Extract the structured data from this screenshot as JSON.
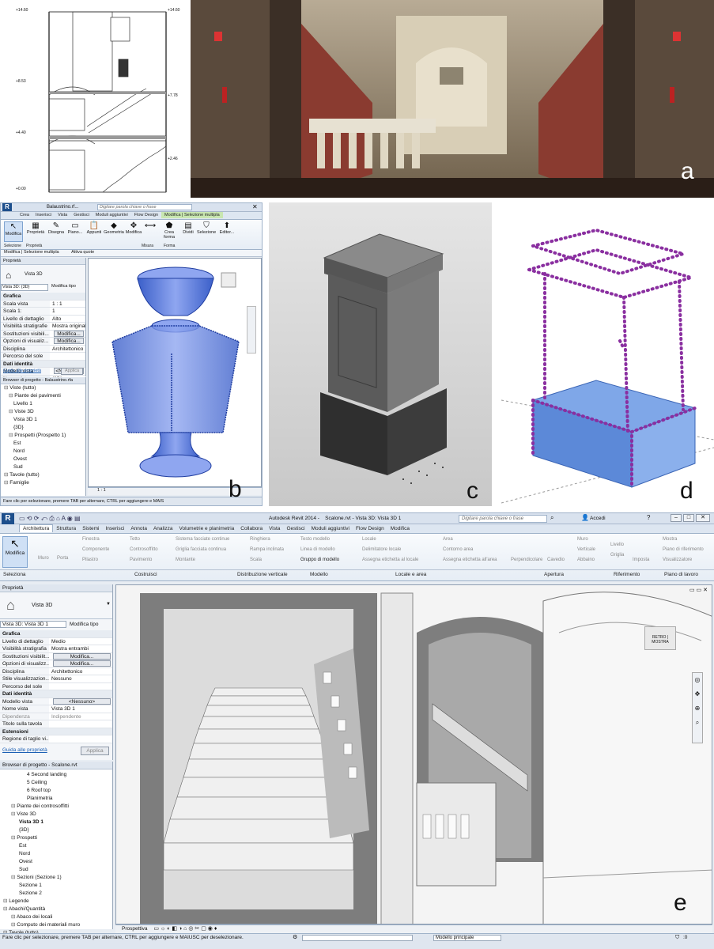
{
  "labels": {
    "a": "a",
    "b": "b",
    "c": "c",
    "d": "d",
    "e": "e"
  },
  "section_drawing": {
    "levels": [
      "+14.60",
      "+8.53",
      "+4.40",
      "+0.00",
      "+14.60",
      "+7.78",
      "+2.46"
    ]
  },
  "revit_small": {
    "file_title": "Balaustrino.rf...",
    "search_placeholder": "Digitare parola chiave o frase",
    "tabs": [
      "Crea",
      "Inserisci",
      "Vista",
      "Gestisci",
      "Moduli aggiuntivi",
      "Flow Design",
      "Modifica | Selezione multipla"
    ],
    "ribbon_buttons": [
      "Modifica",
      "Proprietà",
      "Disegna",
      "Piano...",
      "Appunti",
      "Geometria",
      "Modifica",
      "Misura",
      "Crea forma",
      "Dividi",
      "Selezione",
      "Editor..."
    ],
    "ribbon_groups": [
      "Selezione",
      "Proprietà",
      "Misura",
      "Forma"
    ],
    "context_bar": [
      "Modifica | Selezione multipla",
      "Attiva quote"
    ],
    "properties_title": "Proprietà",
    "view_name": "Vista 3D",
    "view_select": "Vista 3D: (3D)",
    "edit_type": "Modifica tipo",
    "props": [
      {
        "k": "Grafica",
        "v": "",
        "sec": true
      },
      {
        "k": "Scala vista",
        "v": "1 : 1"
      },
      {
        "k": "Scala 1:",
        "v": "1"
      },
      {
        "k": "Livello di dettaglio",
        "v": "Alto"
      },
      {
        "k": "Visibilità stratigrafie",
        "v": "Mostra originale"
      },
      {
        "k": "Sostituzioni visibili...",
        "v": "Modifica...",
        "btn": true
      },
      {
        "k": "Opzioni di visualiz...",
        "v": "Modifica...",
        "btn": true
      },
      {
        "k": "Disciplina",
        "v": "Architettonico"
      },
      {
        "k": "Percorso del sole",
        "v": ""
      },
      {
        "k": "Dati identità",
        "v": "",
        "sec": true
      },
      {
        "k": "Modello vista",
        "v": "<Nessuno>",
        "btn": true
      },
      {
        "k": "Nome vista",
        "v": "{3D}"
      },
      {
        "k": "Dipendenza",
        "v": "Indipendente",
        "dis": true
      }
    ],
    "help_link": "Guida alle proprietà",
    "apply": "Applica",
    "browser_title": "Browser di progetto - Balaustrino.rfa",
    "tree": [
      {
        "t": "Viste (tutto)",
        "d": 0
      },
      {
        "t": "Piante dei pavimenti",
        "d": 1
      },
      {
        "t": "Livello 1",
        "d": 2
      },
      {
        "t": "Viste 3D",
        "d": 1
      },
      {
        "t": "Vista 3D 1",
        "d": 2
      },
      {
        "t": "{3D}",
        "d": 2
      },
      {
        "t": "Prospetti (Prospetto 1)",
        "d": 1
      },
      {
        "t": "Est",
        "d": 2
      },
      {
        "t": "Nord",
        "d": 2
      },
      {
        "t": "Ovest",
        "d": 2
      },
      {
        "t": "Sud",
        "d": 2
      },
      {
        "t": "Tavole (tutto)",
        "d": 0
      },
      {
        "t": "Famiglie",
        "d": 0
      }
    ],
    "scale": "1 : 1",
    "status": "Fare clic per selezionare, premere TAB per alternare, CTRL per aggiungere e MAIS"
  },
  "revit_large": {
    "app_title": "Autodesk Revit 2014 -    Scalone.rvt - Vista 3D: Vista 3D 1",
    "search_placeholder": "Digitare parola chiave o frase",
    "login": "Accedi",
    "tabs": [
      "Architettura",
      "Struttura",
      "Sistemi",
      "Inserisci",
      "Annota",
      "Analizza",
      "Volumetrie e planimetria",
      "Collabora",
      "Vista",
      "Gestisci",
      "Moduli aggiuntivi",
      "Flow Design",
      "Modifica"
    ],
    "ribbon": {
      "modifica": "Modifica",
      "muro": "Muro",
      "porta": "Porta",
      "finestra": "Finestra",
      "componente": "Componente",
      "pilastro": "Pilastro",
      "tetto": "Tetto",
      "controsoffitto": "Controsoffitto",
      "pavimento": "Pavimento",
      "sistema_facciate": "Sistema facciate continue",
      "griglia_facciata": "Griglia facciata continua",
      "montante": "Montante",
      "ringhiera": "Ringhiera",
      "rampa": "Rampa inclinata",
      "scala": "Scala",
      "testo_modello": "Testo modello",
      "linea_modello": "Linea di modello",
      "gruppo_modello": "Gruppo di modello",
      "locale": "Locale",
      "delimitatore": "Delimitatore locale",
      "assegna_loc": "Assegna etichetta al locale",
      "area": "Area",
      "contorno": "Contorno area",
      "assegna_area": "Assegna etichetta all'area",
      "perpendicolare": "Perpendicolare",
      "cavedio": "Cavedio",
      "muro2": "Muro",
      "verticale": "Verticale",
      "abbaino": "Abbaino",
      "livello": "Livello",
      "griglia": "Griglia",
      "imposta": "Imposta",
      "mostra": "Mostra",
      "piano_rif": "Piano di riferimento",
      "visualizzatore": "Visualizzatore"
    },
    "groups": [
      "Seleziona",
      "Costruisci",
      "Distribuzione verticale",
      "Modello",
      "Locale e area",
      "Apertura",
      "Riferimento",
      "Piano di lavoro"
    ],
    "properties_title": "Proprietà",
    "view_name": "Vista 3D",
    "view_select": "Vista 3D: Vista 3D 1",
    "edit_type": "Modifica tipo",
    "props": [
      {
        "k": "Grafica",
        "v": "",
        "sec": true
      },
      {
        "k": "Livello di dettaglio",
        "v": "Medio"
      },
      {
        "k": "Visibilità stratigrafia",
        "v": "Mostra entrambi"
      },
      {
        "k": "Sostituzioni visibilit...",
        "v": "Modifica...",
        "btn": true
      },
      {
        "k": "Opzioni di visualizz...",
        "v": "Modifica...",
        "btn": true
      },
      {
        "k": "Disciplina",
        "v": "Architettonico"
      },
      {
        "k": "Stile visualizzazion...",
        "v": "Nessuno"
      },
      {
        "k": "Percorso del sole",
        "v": ""
      },
      {
        "k": "Dati identità",
        "v": "",
        "sec": true
      },
      {
        "k": "Modello vista",
        "v": "<Nessuno>",
        "btn": true
      },
      {
        "k": "Nome vista",
        "v": "Vista 3D 1"
      },
      {
        "k": "Dipendenza",
        "v": "Indipendente",
        "dis": true
      },
      {
        "k": "Titolo sulla tavola",
        "v": ""
      },
      {
        "k": "Estensioni",
        "v": "",
        "sec": true
      },
      {
        "k": "Regione di taglio vi...",
        "v": ""
      }
    ],
    "help_link": "Guida alle proprietà",
    "apply": "Applica",
    "browser_title": "Browser di progetto - Scalone.rvt",
    "tree": [
      {
        "t": "4 Second landing",
        "d": 3
      },
      {
        "t": "5 Ceiling",
        "d": 3
      },
      {
        "t": "6 Roof top",
        "d": 3
      },
      {
        "t": "Planimetria",
        "d": 3
      },
      {
        "t": "Piante dei controsoffitti",
        "d": 1
      },
      {
        "t": "Viste 3D",
        "d": 1
      },
      {
        "t": "Vista 3D 1",
        "d": 2,
        "bold": true
      },
      {
        "t": "{3D}",
        "d": 2
      },
      {
        "t": "Prospetti",
        "d": 1
      },
      {
        "t": "Est",
        "d": 2
      },
      {
        "t": "Nord",
        "d": 2
      },
      {
        "t": "Ovest",
        "d": 2
      },
      {
        "t": "Sud",
        "d": 2
      },
      {
        "t": "Sezioni (Sezione 1)",
        "d": 1
      },
      {
        "t": "Sezione 1",
        "d": 2
      },
      {
        "t": "Sezione 2",
        "d": 2
      },
      {
        "t": "Legende",
        "d": 0
      },
      {
        "t": "Abachi/Quantità",
        "d": 0
      },
      {
        "t": "Abaco dei locali",
        "d": 1
      },
      {
        "t": "Computo dei materiali muro",
        "d": 1
      },
      {
        "t": "Tavole (tutto)",
        "d": 0
      }
    ],
    "view_mode": "Prospettiva",
    "status": "Fare clic per selezionare, premere TAB per alternare, CTRL per aggiungere e MAIUSC per deselezionare.",
    "model": "Modello principale",
    "filter_count": ":0",
    "nav_labels": [
      "RETRO",
      "MOSTRA"
    ]
  }
}
